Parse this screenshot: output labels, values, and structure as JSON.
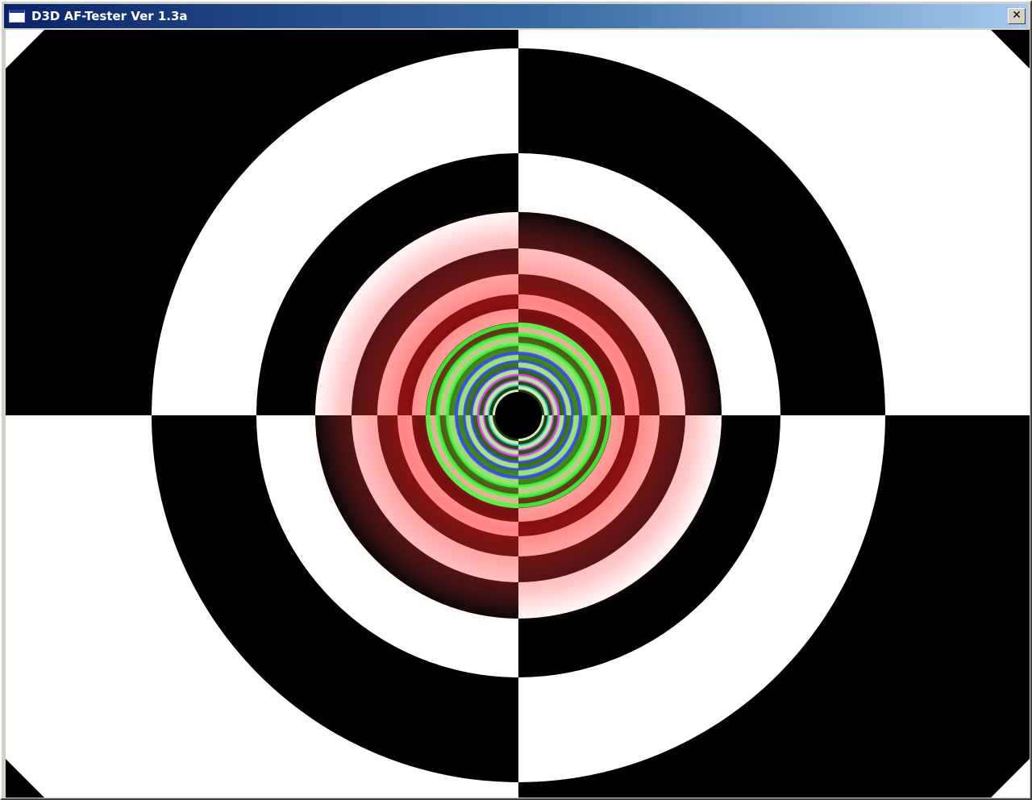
{
  "window": {
    "title": "D3D AF-Tester Ver 1.3a",
    "close_glyph": "✕",
    "app_icon": "window-icon",
    "close_icon": "close-icon"
  },
  "colors": {
    "titlebar_start": "#0a246a",
    "titlebar_end": "#a6caf0",
    "pattern_dark": "#000000",
    "pattern_light": "#ffffff",
    "mip_red": "#ff5a5a",
    "mip_green": "#3cff3c",
    "mip_blue": "#3c3cff",
    "mip_magenta": "#e040ff",
    "mip_cyan": "#30d0d0"
  }
}
